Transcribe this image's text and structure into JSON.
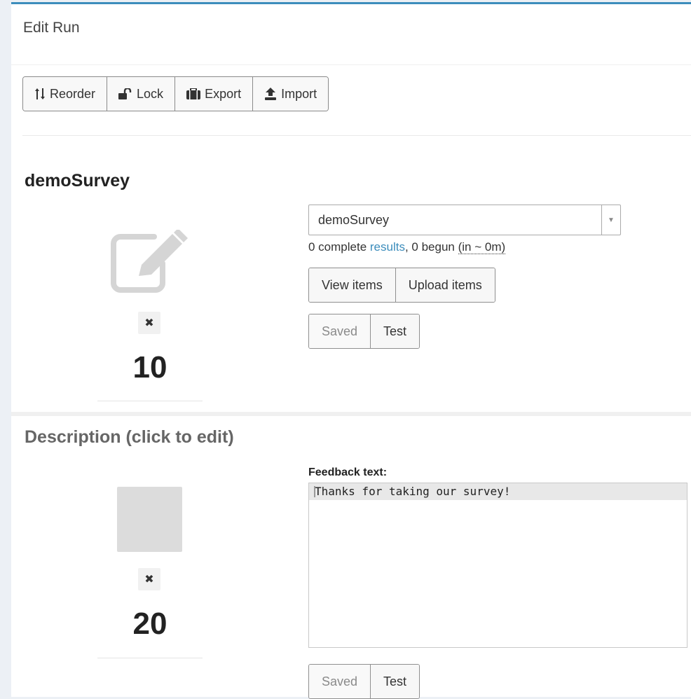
{
  "panel": {
    "title": "Edit Run"
  },
  "toolbar": {
    "reorder_label": "Reorder",
    "lock_label": "Lock",
    "export_label": "Export",
    "import_label": "Import"
  },
  "unit1": {
    "title": "demoSurvey",
    "select_value": "demoSurvey",
    "stats_prefix": "0 complete ",
    "stats_link": "results",
    "stats_middle": ", 0 begun ",
    "stats_abbr": "(in ~ 0m)",
    "view_items_label": "View items",
    "upload_items_label": "Upload items",
    "saved_label": "Saved",
    "test_label": "Test",
    "remove_symbol": "✖",
    "position": "10"
  },
  "unit2": {
    "title": "Description (click to edit)",
    "feedback_label": "Feedback text:",
    "feedback_text": "Thanks for taking our survey!",
    "saved_label": "Saved",
    "test_label": "Test",
    "remove_symbol": "✖",
    "position": "20"
  },
  "colors": {
    "accent": "#3c8dbc",
    "background": "#ecf0f5",
    "panel": "#ffffff"
  }
}
